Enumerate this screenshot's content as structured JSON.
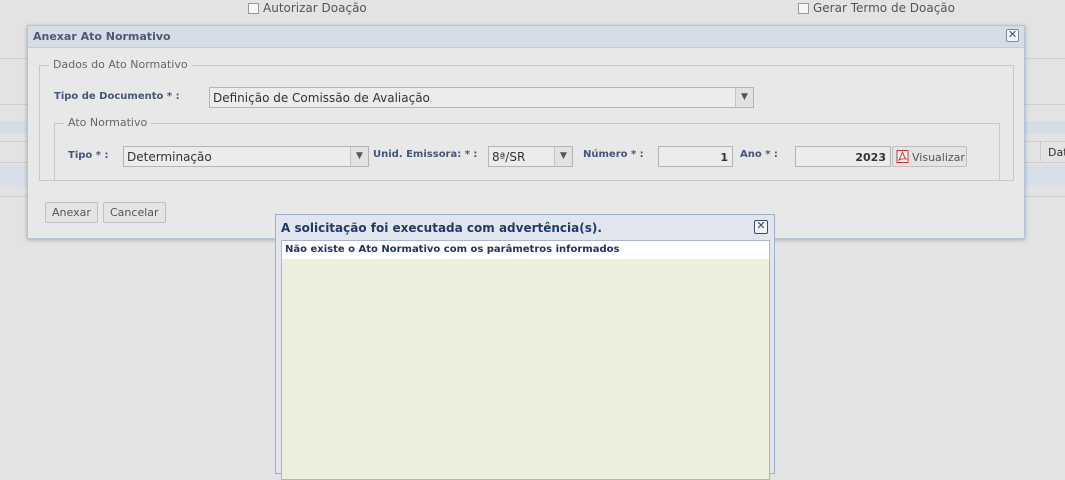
{
  "background": {
    "authorize_donation_label": "Autorizar Doação",
    "generate_term_label": "Gerar Termo de Doação",
    "column_header_partial": "Dat"
  },
  "dialog": {
    "title": "Anexar Ato Normativo",
    "fieldset_legend": "Dados do Ato Normativo",
    "doc_type_label": "Tipo de Documento * :",
    "doc_type_value": "Definição de Comissão de Avaliação",
    "inner_legend": "Ato Normativo",
    "tipo_label": "Tipo * :",
    "tipo_value": "Determinação",
    "unid_label": "Unid. Emissora: * :",
    "unid_value": "8ª/SR",
    "numero_label": "Número * :",
    "numero_value": "1",
    "ano_label": "Ano * :",
    "ano_value": "2023",
    "view_button": "Visualizar",
    "attach_button": "Anexar",
    "cancel_button": "Cancelar",
    "close_symbol": "✕"
  },
  "warning": {
    "title": "A solicitação foi executada com advertência(s).",
    "message": "Não existe o Ato Normativo com os parâmetros informados",
    "close_symbol": "✕"
  },
  "colors": {
    "label_blue": "#44557a",
    "title_navy": "#1f3b66",
    "pdf_red": "#d0312d"
  },
  "icons": {
    "dropdown": "chevron-down-icon",
    "pdf": "pdf-icon",
    "close": "close-icon"
  }
}
